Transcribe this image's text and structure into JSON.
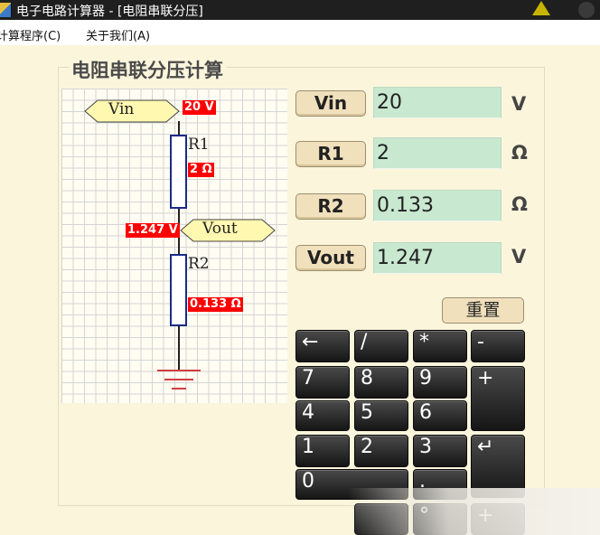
{
  "window": {
    "title": "电子电路计算器 - [电阻串联分压]"
  },
  "menu": {
    "items": [
      "计算程序(C)",
      "关于我们(A)"
    ]
  },
  "group": {
    "title": "电阻串联分压计算"
  },
  "circuit": {
    "vin_label": "Vin",
    "vout_label": "Vout",
    "r1_label": "R1",
    "r2_label": "R2",
    "vin_value": "20 V",
    "r1_value": "2 Ω",
    "vout_value": "1.247 V",
    "r2_value": "0.133 Ω"
  },
  "fields": [
    {
      "label": "Vin",
      "value": "20",
      "unit": "V"
    },
    {
      "label": "R1",
      "value": "2",
      "unit": "Ω"
    },
    {
      "label": "R2",
      "value": "0.133",
      "unit": "Ω"
    },
    {
      "label": "Vout",
      "value": "1.247",
      "unit": "V"
    }
  ],
  "reset_label": "重置",
  "keypad": {
    "back": "←",
    "divide": "/",
    "multiply": "*",
    "minus": "-",
    "d7": "7",
    "d8": "8",
    "d9": "9",
    "plus": "+",
    "d4": "4",
    "d5": "5",
    "d6": "6",
    "d1": "1",
    "d2": "2",
    "d3": "3",
    "enter": "↵",
    "d0": "0",
    "dot": ".",
    "degree": "°",
    "plus2": "+"
  },
  "colors": {
    "background": "#fbf5dc",
    "input_bg": "#c8e8d0",
    "value_tag": "#ff0000",
    "label_fill": "#fff8b0"
  }
}
